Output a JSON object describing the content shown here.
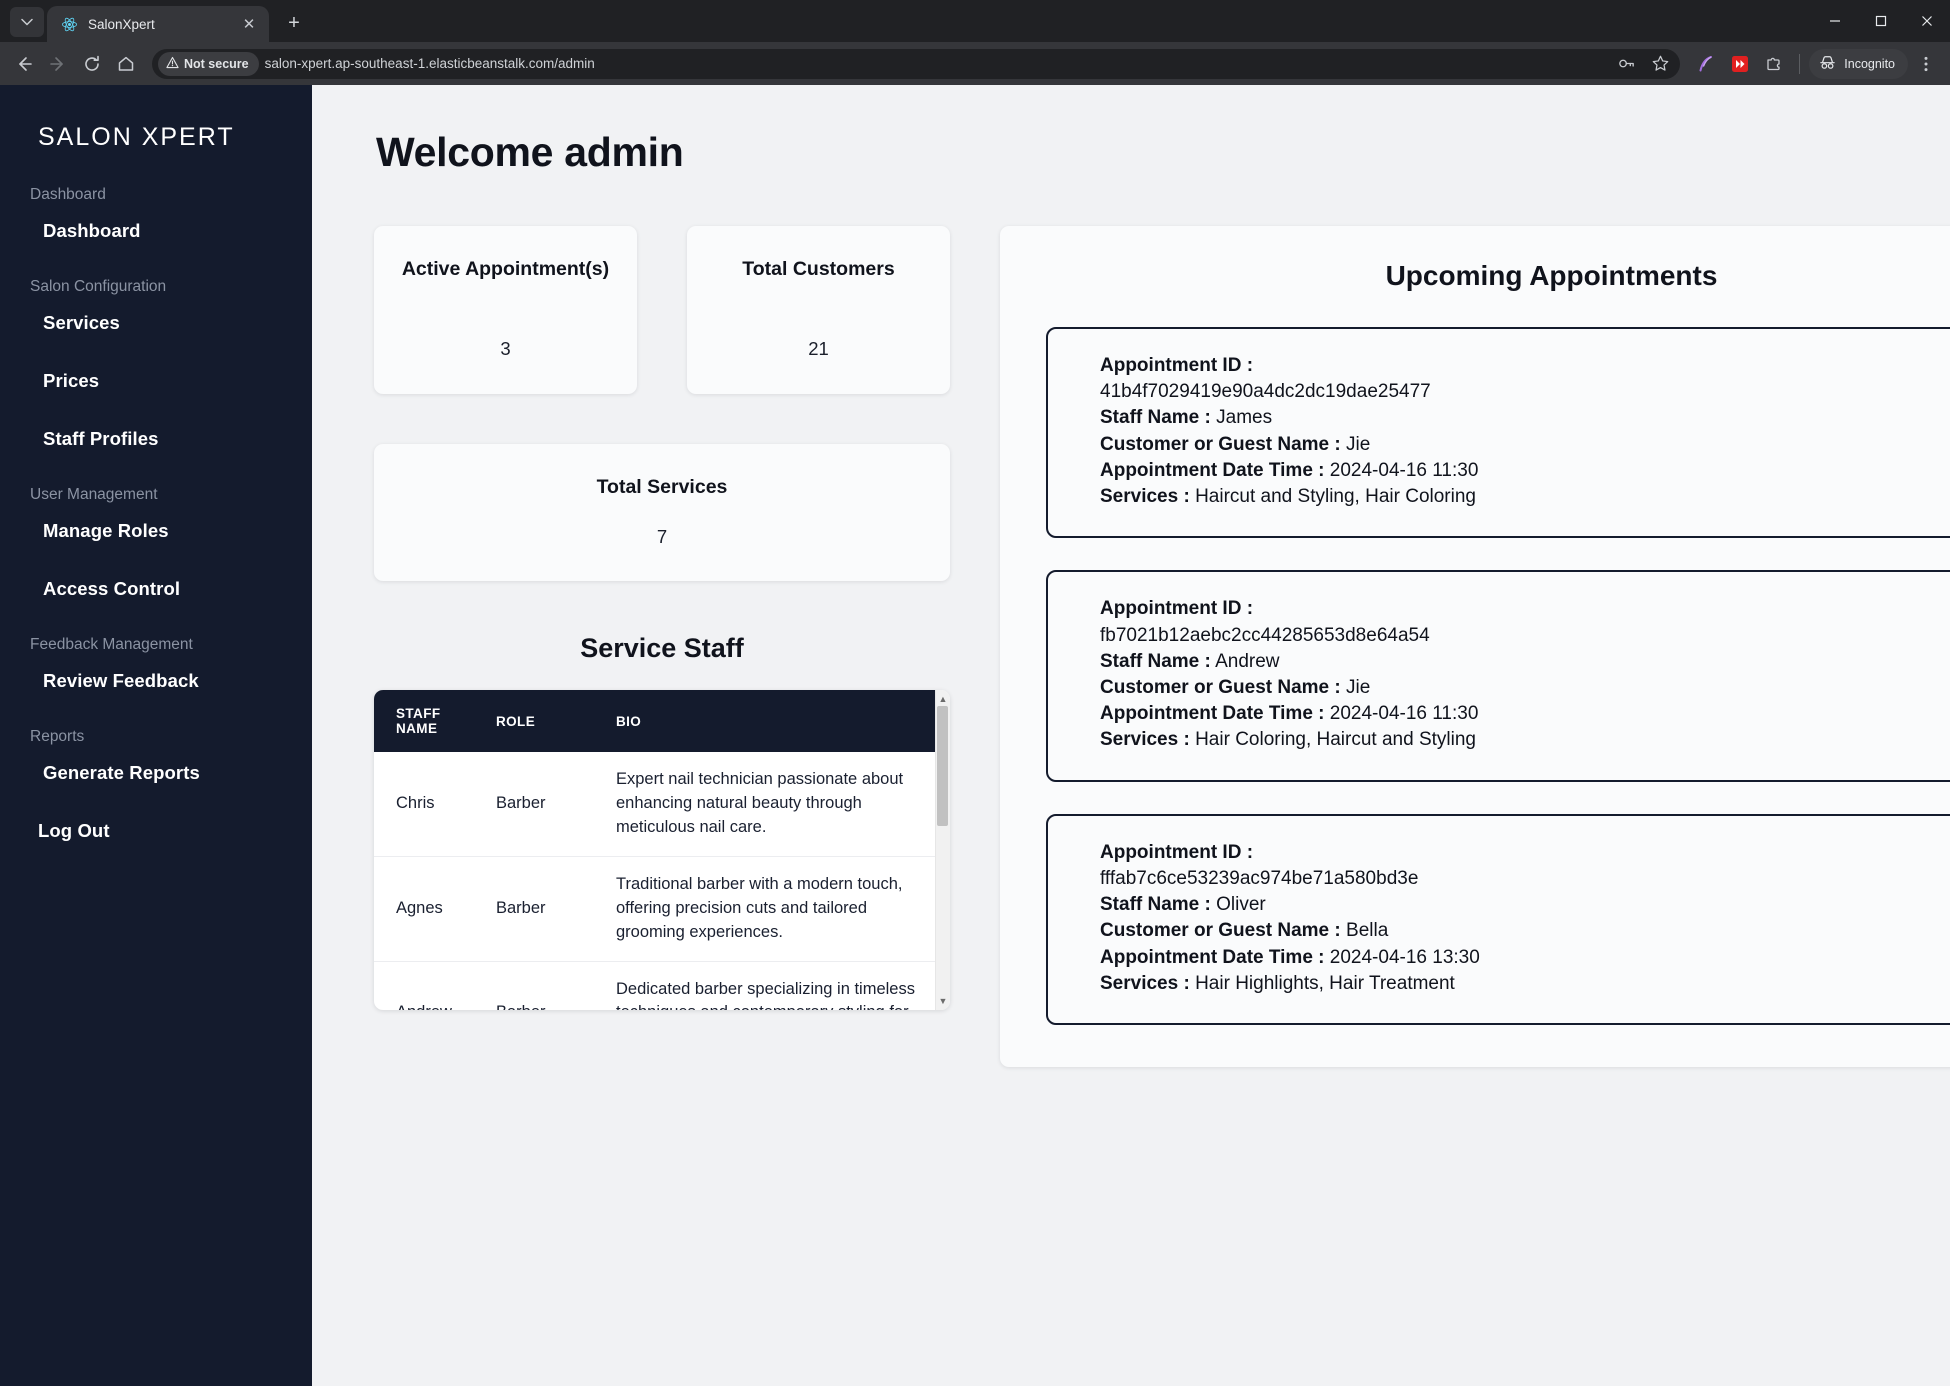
{
  "browser": {
    "tab": {
      "title": "SalonXpert",
      "favicon_icon": "react-atom-icon",
      "close_icon": "close-icon"
    },
    "tab_list_icon": "chevron-down-icon",
    "new_tab_icon": "plus-icon",
    "window_controls": {
      "minimize": "minimize-icon",
      "maximize": "maximize-icon",
      "close": "close-icon"
    },
    "nav": {
      "back_icon": "back-arrow-icon",
      "forward_icon": "forward-arrow-icon",
      "reload_icon": "reload-icon",
      "home_icon": "home-icon"
    },
    "omnibox": {
      "security_label": "Not secure",
      "security_icon": "warning-triangle-icon",
      "url": "salon-xpert.ap-southeast-1.elasticbeanstalk.com/admin",
      "password_icon": "key-icon",
      "bookmark_icon": "star-icon"
    },
    "toolbar_icons": [
      "feather-extension-icon",
      "fast-forward-extension-icon",
      "extensions-puzzle-icon"
    ],
    "incognito": {
      "label": "Incognito",
      "icon": "incognito-hat-icon"
    },
    "menu_icon": "three-dot-menu-icon"
  },
  "sidebar": {
    "brand": "SALON XPERT",
    "groups": [
      {
        "label": "Dashboard",
        "items": [
          {
            "label": "Dashboard"
          }
        ]
      },
      {
        "label": "Salon Configuration",
        "items": [
          {
            "label": "Services"
          },
          {
            "label": "Prices"
          },
          {
            "label": "Staff Profiles"
          }
        ]
      },
      {
        "label": "User Management",
        "items": [
          {
            "label": "Manage Roles"
          },
          {
            "label": "Access Control"
          }
        ]
      },
      {
        "label": "Feedback Management",
        "items": [
          {
            "label": "Review Feedback"
          }
        ]
      },
      {
        "label": "Reports",
        "items": [
          {
            "label": "Generate Reports"
          }
        ]
      }
    ],
    "logout": "Log Out"
  },
  "main": {
    "page_title": "Welcome admin",
    "stats": [
      {
        "label": "Active Appointment(s)",
        "value": "3"
      },
      {
        "label": "Total Customers",
        "value": "21"
      },
      {
        "label": "Total Services",
        "value": "7"
      }
    ],
    "service_staff": {
      "title": "Service Staff",
      "columns": [
        "STAFF NAME",
        "ROLE",
        "BIO"
      ],
      "rows": [
        {
          "name": "Chris",
          "role": "Barber",
          "bio": "Expert nail technician passionate about enhancing natural beauty through meticulous nail care."
        },
        {
          "name": "Agnes",
          "role": "Barber",
          "bio": "Traditional barber with a modern touch, offering precision cuts and tailored grooming experiences."
        },
        {
          "name": "Andrew",
          "role": "Barber",
          "bio": "Dedicated barber specializing in timeless techniques and contemporary styling for the modern gentlemen."
        }
      ]
    },
    "appointments": {
      "title": "Upcoming Appointments",
      "labels": {
        "id": "Appointment ID :",
        "staff": "Staff Name :",
        "customer": "Customer or Guest Name :",
        "datetime": "Appointment Date Time :",
        "services": "Services :"
      },
      "items": [
        {
          "id": "41b4f7029419e90a4dc2dc19dae25477",
          "staff": "James",
          "customer": "Jie",
          "datetime": "2024-04-16 11:30",
          "services": "Haircut and Styling, Hair Coloring"
        },
        {
          "id": "fb7021b12aebc2cc44285653d8e64a54",
          "staff": "Andrew",
          "customer": "Jie",
          "datetime": "2024-04-16 11:30",
          "services": "Hair Coloring, Haircut and Styling"
        },
        {
          "id": "fffab7c6ce53239ac974be71a580bd3e",
          "staff": "Oliver",
          "customer": "Bella",
          "datetime": "2024-04-16 13:30",
          "services": "Hair Highlights, Hair Treatment"
        }
      ]
    }
  },
  "colors": {
    "sidebar_bg": "#141b2d",
    "page_bg": "#f1f2f4",
    "card_bg": "#fafbfc",
    "text_dark": "#10131c",
    "muted": "#8b93a3"
  }
}
